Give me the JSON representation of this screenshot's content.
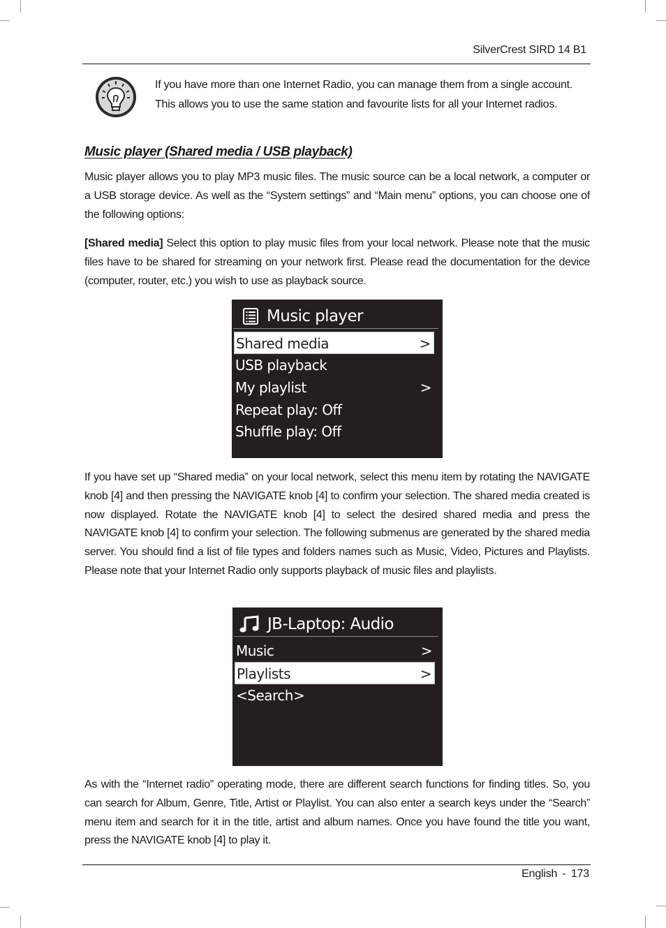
{
  "header": {
    "title": "SilverCrest SIRD 14 B1"
  },
  "tip": {
    "icon": "lightbulb-icon",
    "text": "If you have more than one Internet Radio, you can manage them from a single account. This allows you to use the same station and favourite lists for all your Internet radios."
  },
  "section": {
    "heading": "Music player (Shared media / USB playback)",
    "paragraph1": "Music player allows you to play MP3 music files. The music source can be a local network, a computer or a USB storage device. As well as the “System settings” and “Main menu” options, you can choose one of the following options:",
    "paragraph2_bold": "[Shared media]",
    "paragraph2_rest": " Select this option to play music files from your local network. Please note that the music files have to be shared for streaming on your network first. Please read the documentation for the device (computer, router, etc.) you wish to use as playback source.",
    "paragraph3": "If you have set up “Shared media” on your local network, select this menu item by rotating the NAVIGATE knob [4] and then pressing the NAVIGATE knob [4] to confirm your selection. The shared media created is now displayed. Rotate the NAVIGATE knob [4] to select the desired shared media and press the NAVIGATE knob [4] to confirm your selection. The following submenus are generated by the shared media server. You should find a list of file types and folders names such as Music, Video, Pictures and Playlists. Please note that your Internet Radio only supports playback of music files and playlists.",
    "paragraph4": "As with the “Internet radio” operating mode, there are different search functions for finding titles. So, you can search for Album, Genre, Title, Artist or Playlist. You can also enter a search keys under the “Search” menu item and search for it in the title, artist and album names. Once you have found the title you want, press the NAVIGATE knob [4] to play it."
  },
  "screen1": {
    "icon": "list-icon",
    "title": "Music player",
    "items": [
      {
        "label": "Shared media",
        "arrow": ">",
        "selected": true
      },
      {
        "label": "USB playback",
        "arrow": "",
        "selected": false
      },
      {
        "label": "My playlist",
        "arrow": ">",
        "selected": false
      },
      {
        "label": "Repeat play: Off",
        "arrow": "",
        "selected": false
      },
      {
        "label": "Shuffle play: Off",
        "arrow": "",
        "selected": false
      }
    ]
  },
  "screen2": {
    "icon": "music-note-icon",
    "title": "JB-Laptop: Audio",
    "items": [
      {
        "label": "Music",
        "arrow": ">",
        "selected": false
      },
      {
        "label": "Playlists",
        "arrow": ">",
        "selected": true
      },
      {
        "label": "<Search>",
        "arrow": "",
        "selected": false
      }
    ]
  },
  "footer": {
    "language": "English",
    "separator": "-",
    "page_number": "173"
  },
  "colors": {
    "lcd_background": "#231f20",
    "lcd_text": "#ffffff",
    "selection_background": "#ffffff"
  }
}
